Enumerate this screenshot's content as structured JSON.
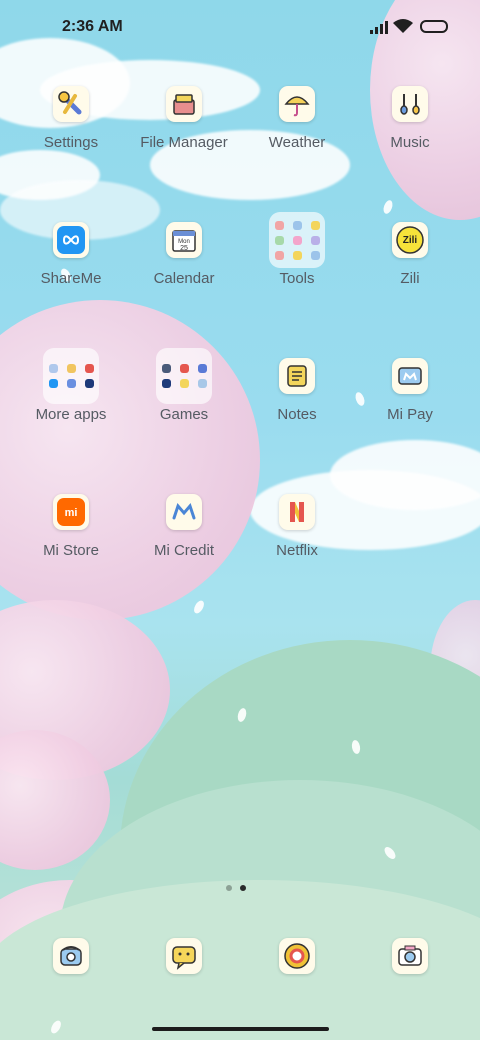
{
  "status_bar": {
    "time": "2:36 AM"
  },
  "apps": [
    {
      "label": "Settings",
      "icon": "wrench-icon",
      "name": "app-settings"
    },
    {
      "label": "File Manager",
      "icon": "folder-box-icon",
      "name": "app-file-manager"
    },
    {
      "label": "Weather",
      "icon": "umbrella-icon",
      "name": "app-weather"
    },
    {
      "label": "Music",
      "icon": "earphones-icon",
      "name": "app-music"
    },
    {
      "label": "ShareMe",
      "icon": "infinity-icon",
      "name": "app-shareme"
    },
    {
      "label": "Calendar",
      "icon": "calendar-icon",
      "name": "app-calendar",
      "icon_text": [
        "Mon",
        "25"
      ]
    },
    {
      "label": "Tools",
      "icon": "folder-icon",
      "name": "folder-tools"
    },
    {
      "label": "Zili",
      "icon": "zili-icon",
      "name": "app-zili",
      "icon_text": [
        "Zili"
      ]
    },
    {
      "label": "More apps",
      "icon": "folder-icon",
      "name": "folder-more-apps"
    },
    {
      "label": "Games",
      "icon": "folder-icon",
      "name": "folder-games"
    },
    {
      "label": "Notes",
      "icon": "notepad-icon",
      "name": "app-notes"
    },
    {
      "label": "Mi Pay",
      "icon": "wallet-icon",
      "name": "app-mi-pay"
    },
    {
      "label": "Mi Store",
      "icon": "mi-logo-icon",
      "name": "app-mi-store",
      "icon_text": [
        "mi"
      ]
    },
    {
      "label": "Mi Credit",
      "icon": "mi-credit-icon",
      "name": "app-mi-credit"
    },
    {
      "label": "Netflix",
      "icon": "netflix-n-icon",
      "name": "app-netflix"
    }
  ],
  "dock": [
    {
      "icon": "phone-icon",
      "name": "dock-phone"
    },
    {
      "icon": "message-icon",
      "name": "dock-messages"
    },
    {
      "icon": "browser-icon",
      "name": "dock-browser"
    },
    {
      "icon": "camera-icon",
      "name": "dock-camera"
    }
  ],
  "page_indicator": {
    "count": 2,
    "active": 2
  },
  "colors": {
    "label": "#555b63",
    "icon_bg": "#fffbea",
    "accent_blue": "#2196f3",
    "mi_orange": "#ff6900"
  }
}
